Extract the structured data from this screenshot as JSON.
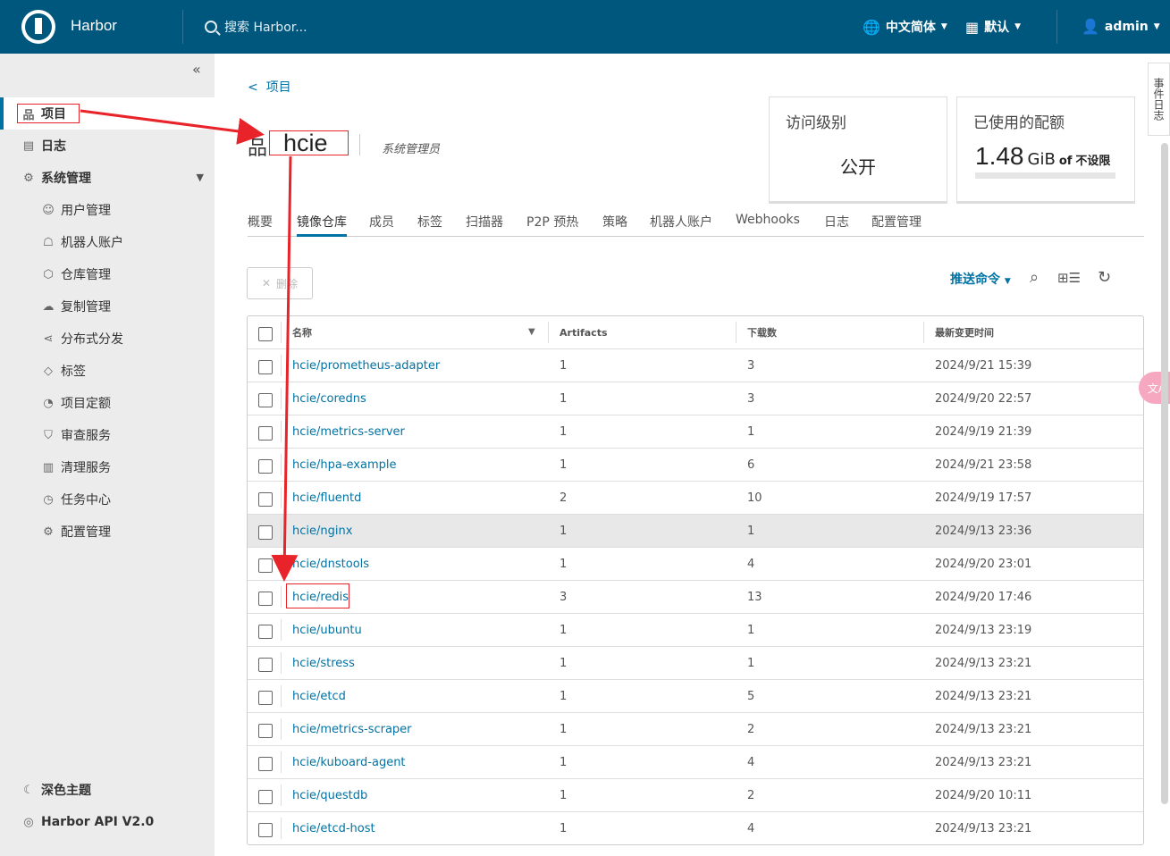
{
  "header": {
    "brand": "Harbor",
    "search_placeholder": "搜索 Harbor...",
    "language": "中文简体",
    "theme": "默认",
    "user": "admin"
  },
  "sidebar": {
    "items": [
      {
        "label": "项目",
        "icon": "project-icon"
      },
      {
        "label": "日志",
        "icon": "log-icon"
      },
      {
        "label": "系统管理",
        "icon": "admin-icon"
      },
      {
        "label": "用户管理",
        "icon": "users-icon"
      },
      {
        "label": "机器人账户",
        "icon": "robot-icon"
      },
      {
        "label": "仓库管理",
        "icon": "registry-icon"
      },
      {
        "label": "复制管理",
        "icon": "cloud-icon"
      },
      {
        "label": "分布式分发",
        "icon": "share-icon"
      },
      {
        "label": "标签",
        "icon": "tag-icon"
      },
      {
        "label": "项目定额",
        "icon": "quota-icon"
      },
      {
        "label": "审查服务",
        "icon": "shield-icon"
      },
      {
        "label": "清理服务",
        "icon": "trash-icon"
      },
      {
        "label": "任务中心",
        "icon": "dashboard-icon"
      },
      {
        "label": "配置管理",
        "icon": "gear-icon"
      }
    ],
    "dark_theme": "深色主题",
    "api": "Harbor API V2.0"
  },
  "project": {
    "back_label": "项目",
    "name": "hcie",
    "role": "系统管理员"
  },
  "cards": {
    "access_title": "访问级别",
    "access_value": "公开",
    "quota_title": "已使用的配额",
    "quota_number": "1.48",
    "quota_unit": "GiB",
    "quota_of": "of",
    "quota_limit": "不设限"
  },
  "tabs": [
    "概要",
    "镜像仓库",
    "成员",
    "标签",
    "扫描器",
    "P2P 预热",
    "策略",
    "机器人账户",
    "Webhooks",
    "日志",
    "配置管理"
  ],
  "toolbar": {
    "delete_label": "删除",
    "push_label": "推送命令"
  },
  "table": {
    "headers": [
      "名称",
      "Artifacts",
      "下载数",
      "最新变更时间"
    ],
    "rows": [
      [
        "hcie/prometheus-adapter",
        "1",
        "3",
        "2024/9/21 15:39"
      ],
      [
        "hcie/coredns",
        "1",
        "3",
        "2024/9/20 22:57"
      ],
      [
        "hcie/metrics-server",
        "1",
        "1",
        "2024/9/19 21:39"
      ],
      [
        "hcie/hpa-example",
        "1",
        "6",
        "2024/9/21 23:58"
      ],
      [
        "hcie/fluentd",
        "2",
        "10",
        "2024/9/19 17:57"
      ],
      [
        "hcie/nginx",
        "1",
        "1",
        "2024/9/13 23:36"
      ],
      [
        "hcie/dnstools",
        "1",
        "4",
        "2024/9/20 23:01"
      ],
      [
        "hcie/redis",
        "3",
        "13",
        "2024/9/20 17:46"
      ],
      [
        "hcie/ubuntu",
        "1",
        "1",
        "2024/9/13 23:19"
      ],
      [
        "hcie/stress",
        "1",
        "1",
        "2024/9/13 23:21"
      ],
      [
        "hcie/etcd",
        "1",
        "5",
        "2024/9/13 23:21"
      ],
      [
        "hcie/metrics-scraper",
        "1",
        "2",
        "2024/9/13 23:21"
      ],
      [
        "hcie/kuboard-agent",
        "1",
        "4",
        "2024/9/13 23:21"
      ],
      [
        "hcie/questdb",
        "1",
        "2",
        "2024/9/20 10:11"
      ],
      [
        "hcie/etcd-host",
        "1",
        "4",
        "2024/9/13 23:21"
      ]
    ]
  },
  "side_tab": "事件日志",
  "translate_label": "文A",
  "colors": {
    "header": "#00577e",
    "accent": "#0072a3",
    "annotation": "#e8232a"
  }
}
